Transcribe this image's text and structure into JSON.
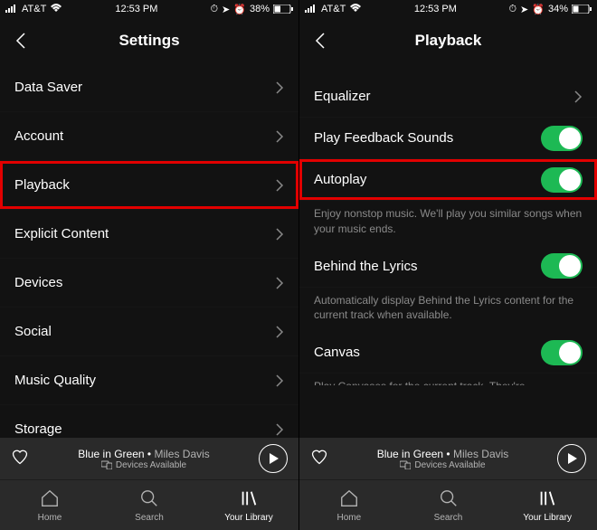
{
  "left": {
    "status": {
      "carrier": "AT&T",
      "time": "12:53 PM",
      "battery": "38%"
    },
    "header": "Settings",
    "items": [
      "Data Saver",
      "Account",
      "Playback",
      "Explicit Content",
      "Devices",
      "Social",
      "Music Quality",
      "Storage"
    ],
    "highlightIndex": 2
  },
  "right": {
    "status": {
      "carrier": "AT&T",
      "time": "12:53 PM",
      "battery": "34%"
    },
    "header": "Playback",
    "rows": [
      {
        "label": "Equalizer",
        "type": "chev"
      },
      {
        "label": "Play Feedback Sounds",
        "type": "toggle",
        "on": true
      },
      {
        "label": "Autoplay",
        "type": "toggle",
        "on": true,
        "desc": "Enjoy nonstop music. We'll play you similar songs when your music ends.",
        "highlight": true
      },
      {
        "label": "Behind the Lyrics",
        "type": "toggle",
        "on": true,
        "desc": "Automatically display Behind the Lyrics content for the current track when available."
      },
      {
        "label": "Canvas",
        "type": "toggle",
        "on": true,
        "desc": "Play Canvases for the current track. They're"
      }
    ]
  },
  "nowPlaying": {
    "song": "Blue in Green",
    "artist": "Miles Davis",
    "devices": "Devices Available"
  },
  "tabs": [
    {
      "label": "Home"
    },
    {
      "label": "Search"
    },
    {
      "label": "Your Library",
      "active": true
    }
  ]
}
